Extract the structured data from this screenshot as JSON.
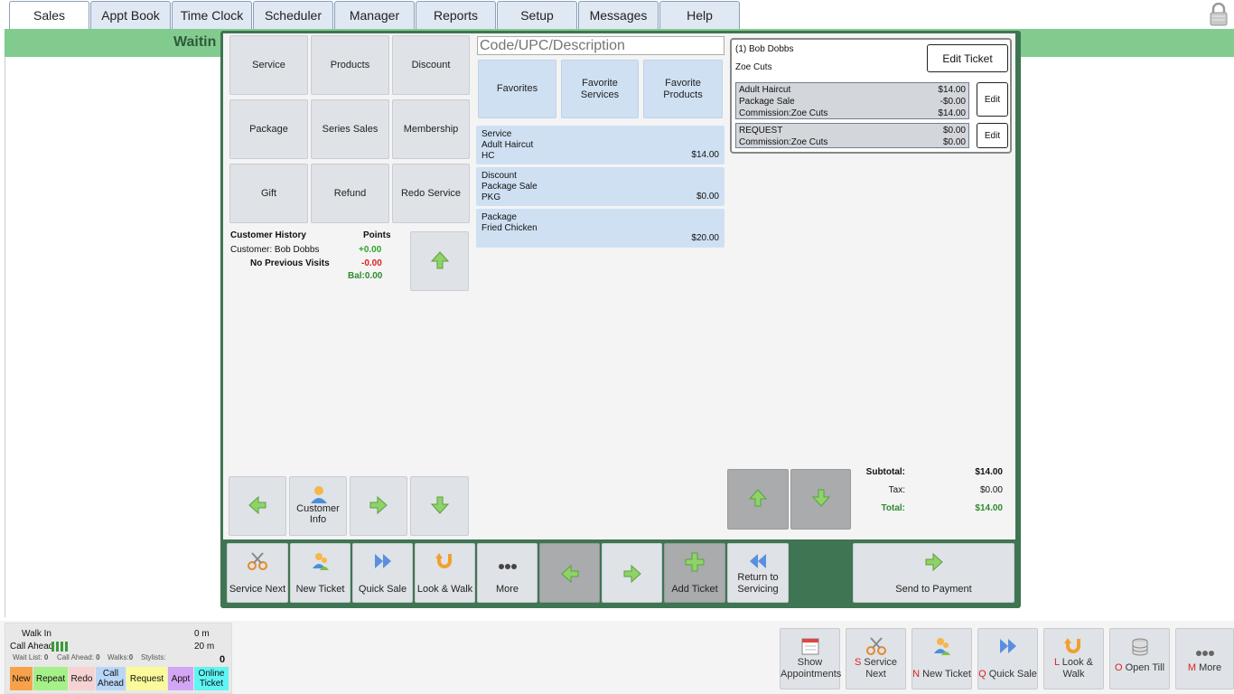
{
  "nav": {
    "tabs": [
      "Sales",
      "Appt Book",
      "Time Clock",
      "Scheduler",
      "Manager",
      "Reports",
      "Setup",
      "Messages",
      "Help"
    ],
    "active": "Sales"
  },
  "waiting_label": "Waitin",
  "categories": [
    "Service",
    "Products",
    "Discount",
    "Package",
    "Series Sales",
    "Membership",
    "Gift",
    "Refund",
    "Redo Service"
  ],
  "history": {
    "title": "Customer History",
    "points_label": "Points",
    "customer": "Customer: Bob Dobbs",
    "plus": "+0.00",
    "no_visits": "No Previous Visits",
    "minus": "-0.00",
    "bal": "Bal:0.00"
  },
  "customer_info_label": "Customer Info",
  "search": {
    "placeholder": "Code/UPC/Description"
  },
  "favorites": [
    "Favorites",
    "Favorite Services",
    "Favorite Products"
  ],
  "items": [
    {
      "l1": "Service",
      "l2": "Adult Haircut",
      "l3": "HC",
      "price": "$14.00"
    },
    {
      "l1": "Discount",
      "l2": "Package Sale",
      "l3": "PKG",
      "price": "$0.00"
    },
    {
      "l1": "Package",
      "l2": "Fried Chicken",
      "l3": "",
      "price": "$20.00"
    }
  ],
  "ticket": {
    "customer": "(1) Bob Dobbs",
    "stylist": "Zoe Cuts",
    "edit_ticket_label": "Edit Ticket",
    "edit_label": "Edit",
    "line1": [
      {
        "name": "Adult Haircut",
        "amount": "$14.00"
      },
      {
        "name": "Package Sale",
        "amount": "-$0.00"
      },
      {
        "name": "Commission:Zoe Cuts",
        "amount": "$14.00"
      }
    ],
    "line2": [
      {
        "name": "REQUEST",
        "amount": "$0.00"
      },
      {
        "name": "Commission:Zoe Cuts",
        "amount": "$0.00"
      }
    ]
  },
  "totals": {
    "subtotal_label": "Subtotal:",
    "subtotal": "$14.00",
    "tax_label": "Tax:",
    "tax": "$0.00",
    "total_label": "Total:",
    "total": "$14.00"
  },
  "actions": {
    "service_next": "Service Next",
    "new_ticket": "New Ticket",
    "quick_sale": "Quick Sale",
    "look_walk": "Look & Walk",
    "more": "More",
    "add_ticket": "Add Ticket",
    "return_servicing": "Return to Servicing",
    "send_payment": "Send to Payment"
  },
  "status": {
    "walk_in": "Walk In",
    "walk_in_time": "0 m",
    "call_ahead": "Call Ahead",
    "call_ahead_time": "20 m",
    "wait_list": "Wait List:",
    "wait_list_v": "0",
    "call_ahead_cnt": "Call Ahead:",
    "call_ahead_cnt_v": "0",
    "walks": "Walks:",
    "walks_v": "0",
    "stylists": "Stylists:",
    "count": "0",
    "chips": [
      {
        "label": "New",
        "color": "#f7a24b"
      },
      {
        "label": "Repeat",
        "color": "#a6f08a"
      },
      {
        "label": "Redo",
        "color": "#f7d2d2"
      },
      {
        "label": "Call Ahead",
        "color": "#b9d6f7"
      },
      {
        "label": "Request",
        "color": "#fbfa9b"
      },
      {
        "label": "Appt",
        "color": "#d3a6f5"
      },
      {
        "label": "Online Ticket",
        "color": "#5ff5f5"
      }
    ]
  },
  "bottom": {
    "show_appts": "Show Appointments",
    "s_key": "S",
    "service_next": " Service Next",
    "n_key": "N",
    "new_ticket": " New Ticket",
    "q_key": "Q",
    "quick_sale": " Quick Sale",
    "l_key": "L",
    "look_walk": " Look & Walk",
    "o_key": "O",
    "open_till": " Open Till",
    "m_key": "M",
    "more": " More"
  }
}
